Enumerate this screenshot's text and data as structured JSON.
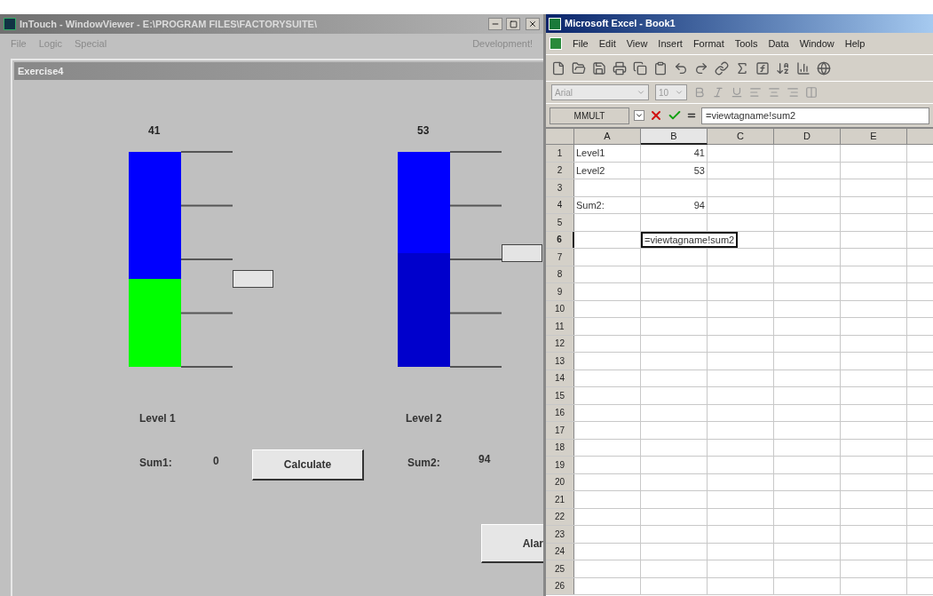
{
  "intouch": {
    "title": "InTouch - WindowViewer - E:\\PROGRAM FILES\\FACTORYSUITE\\",
    "menu": [
      "File",
      "Logic",
      "Special"
    ],
    "mode": "Development!",
    "window_title": "Exercise4",
    "tanks": [
      {
        "value": "41",
        "level": 0.41,
        "color": "#00ff00",
        "label": "Level 1"
      },
      {
        "value": "53",
        "level": 0.53,
        "color": "#0000cc",
        "label": "Level 2"
      }
    ],
    "sums": [
      {
        "label": "Sum1:",
        "value": "0"
      },
      {
        "label": "Sum2:",
        "value": "94"
      }
    ],
    "calculate_button": "Calculate",
    "alarm_button": "Alar"
  },
  "excel": {
    "title": "Microsoft Excel - Book1",
    "menu": [
      "File",
      "Edit",
      "View",
      "Insert",
      "Format",
      "Tools",
      "Data",
      "Window",
      "Help"
    ],
    "font": "Arial",
    "font_size": "10",
    "name_box": "MMULT",
    "formula": "=viewtagname!sum2",
    "columns": [
      "A",
      "B",
      "C",
      "D",
      "E"
    ],
    "rows": [
      {
        "header": "1",
        "cells": [
          {
            "text": "Level1",
            "selected": false
          },
          {
            "text": "41",
            "selected": false
          }
        ]
      },
      {
        "header": "2",
        "cells": [
          {
            "text": "Level2",
            "selected": false
          },
          {
            "text": "53",
            "selected": false
          }
        ]
      },
      {
        "header": "3"
      },
      {
        "header": "4",
        "cells": [
          {
            "text": "Sum2:",
            "selected": false
          },
          {
            "text": "94",
            "selected": false
          }
        ]
      },
      {
        "header": "5"
      },
      {
        "header": "6",
        "cells": [
          null,
          {
            "text": "=viewtagname!sum2",
            "selected": true
          }
        ]
      },
      {
        "header": "7"
      },
      {
        "header": "8"
      },
      {
        "header": "9"
      },
      {
        "header": "10"
      },
      {
        "header": "11"
      },
      {
        "header": "12"
      },
      {
        "header": "13"
      },
      {
        "header": "14"
      },
      {
        "header": "15"
      },
      {
        "header": "16"
      },
      {
        "header": "17"
      },
      {
        "header": "18"
      },
      {
        "header": "19"
      },
      {
        "header": "20"
      },
      {
        "header": "21"
      },
      {
        "header": "22"
      },
      {
        "header": "23"
      },
      {
        "header": "24"
      },
      {
        "header": "25"
      },
      {
        "header": "26"
      }
    ]
  }
}
